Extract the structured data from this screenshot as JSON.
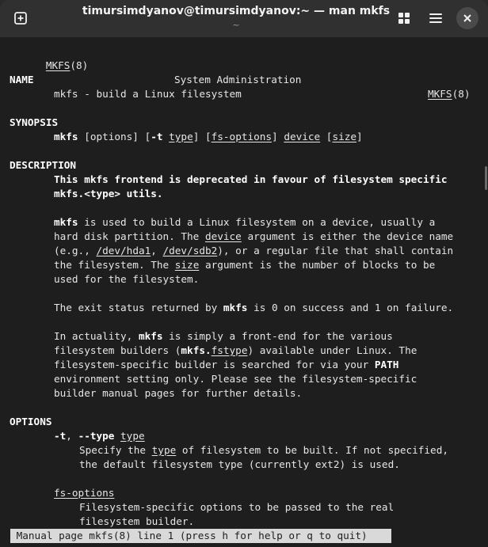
{
  "window": {
    "title": "timursimdyanov@timursimdyanov:~ — man mkfs",
    "subtitle": "~"
  },
  "titlebar_icons": [
    "new-tab-icon",
    "grid-icon",
    "menu-icon",
    "close-icon"
  ],
  "man": {
    "header_left": "MKFS",
    "header_left_sec": "(8)",
    "header_center": "System Administration",
    "header_right": "MKFS",
    "header_right_sec": "(8)",
    "name_heading": "NAME",
    "name_line": "mkfs - build a Linux filesystem",
    "synopsis_heading": "SYNOPSIS",
    "syn": {
      "cmd": "mkfs",
      "p1": " [options] [",
      "t": "-t",
      "sp": " ",
      "type": "type",
      "p2": "] [",
      "fsopt": "fs-options",
      "p3": "] ",
      "device": "device",
      "p4": " [",
      "size": "size",
      "p5": "]"
    },
    "description_heading": "DESCRIPTION",
    "deprecated1": "This mkfs frontend is deprecated in favour of filesystem specific",
    "deprecated2": "mkfs.<type> utils.",
    "d1": {
      "cmd": "mkfs",
      "rest": " is used to build a Linux filesystem on a device, usually a"
    },
    "d2": {
      "pre": "hard disk partition. The ",
      "device": "device",
      "post": " argument is either the device name"
    },
    "d3": {
      "pre": "(e.g., ",
      "hda": "/dev/hda1",
      "mid": ", ",
      "sdb": "/dev/sdb2",
      "post": "), or a regular file that shall contain"
    },
    "d4": {
      "pre": "the filesystem. The ",
      "size": "size",
      "post": " argument is the number of blocks to be"
    },
    "d5": "used for the filesystem.",
    "e1": {
      "pre": "The exit status returned by ",
      "cmd": "mkfs",
      "post": " is 0 on success and 1 on failure."
    },
    "a1": {
      "pre": "In actuality, ",
      "cmd": "mkfs",
      "post": " is simply a front-end for the various"
    },
    "a2": {
      "pre": "filesystem builders (",
      "cmd": "mkfs.",
      "fstype": "fstype",
      "post": ") available under Linux. The"
    },
    "a3": {
      "pre": "filesystem-specific builder is searched for via your ",
      "path": "PATH"
    },
    "a4": "environment setting only. Please see the filesystem-specific",
    "a5": "builder manual pages for further details.",
    "options_heading": "OPTIONS",
    "o1": {
      "t": "-t",
      "comma": ", ",
      "long": "--type",
      "sp": " ",
      "type": "type"
    },
    "o2": {
      "pre": "Specify the ",
      "type": "type",
      "post": " of filesystem to be built. If not specified,"
    },
    "o3": "the default filesystem type (currently ext2) is used.",
    "o4": "fs-options",
    "o5": "Filesystem-specific options to be passed to the real",
    "o6": "filesystem builder.",
    "status": " Manual page mkfs(8) line 1 (press h for help or q to quit)"
  }
}
